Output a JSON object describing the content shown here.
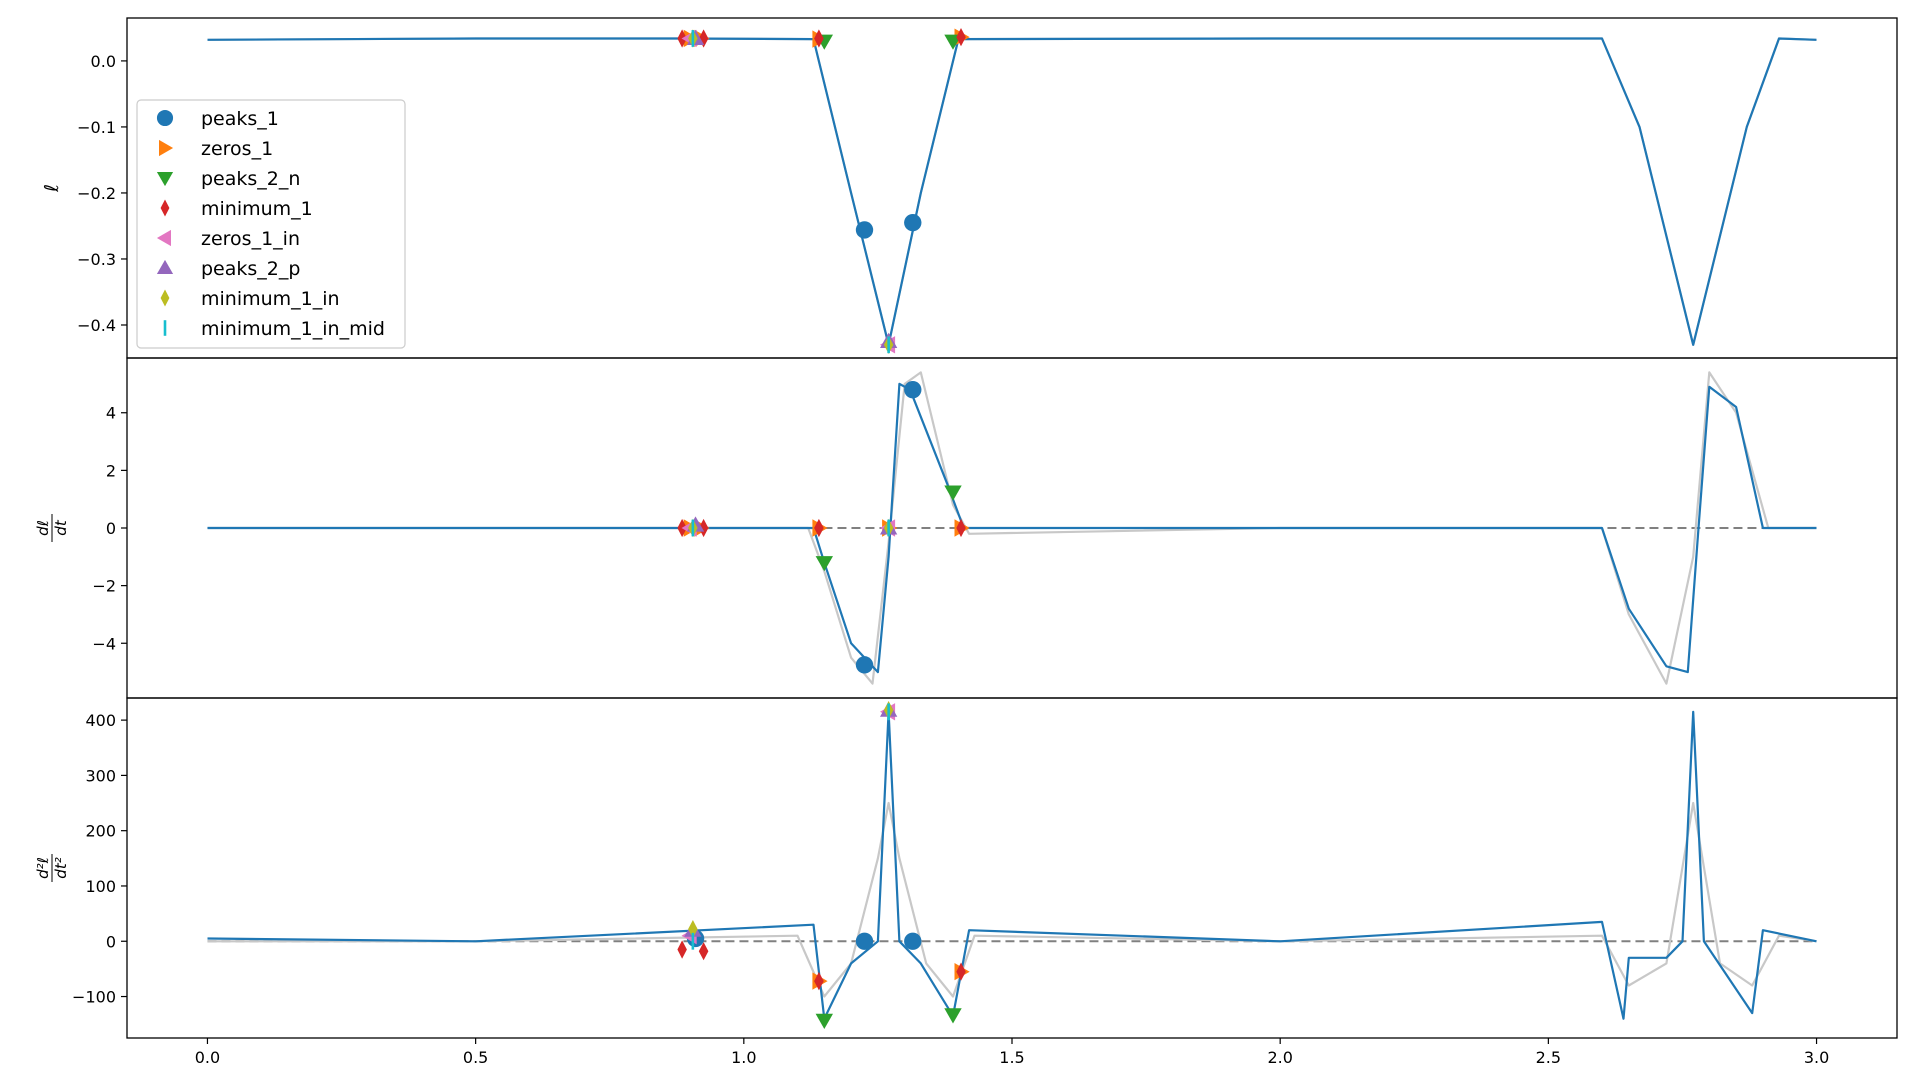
{
  "chart_data": {
    "type": "line",
    "panels": [
      {
        "ylabel": "ℓ",
        "ylim": [
          -0.45,
          0.065
        ],
        "yticks": [
          0.0,
          -0.1,
          -0.2,
          -0.3,
          -0.4
        ],
        "ytick_labels": [
          "0.0",
          "−0.1",
          "−0.2",
          "−0.3",
          "−0.4"
        ],
        "zero_line": false,
        "legend": {
          "placement": "center-left",
          "entries": [
            "peaks_1",
            "zeros_1",
            "peaks_2_n",
            "minimum_1",
            "zeros_1_in",
            "peaks_2_p",
            "minimum_1_in",
            "minimum_1_in_mid"
          ]
        },
        "series": [
          {
            "role": "reference",
            "color": "#c8c8c8",
            "x": [
              0,
              0.5,
              0.88,
              1.13,
              1.2,
              1.27,
              1.33,
              1.4,
              2.0,
              2.6,
              2.67,
              2.77,
              2.87,
              2.93,
              3.0
            ],
            "y": [
              0.032,
              0.034,
              0.034,
              0.033,
              -0.2,
              -0.43,
              -0.2,
              0.033,
              0.034,
              0.034,
              -0.1,
              -0.43,
              -0.1,
              0.034,
              0.032
            ]
          },
          {
            "role": "main",
            "color": "#1f77b4",
            "x": [
              0,
              0.5,
              0.88,
              1.13,
              1.2,
              1.27,
              1.33,
              1.4,
              2.0,
              2.6,
              2.67,
              2.77,
              2.87,
              2.93,
              3.0
            ],
            "y": [
              0.032,
              0.034,
              0.034,
              0.033,
              -0.2,
              -0.43,
              -0.2,
              0.033,
              0.034,
              0.034,
              -0.1,
              -0.43,
              -0.1,
              0.034,
              0.032
            ]
          }
        ],
        "markers": [
          {
            "name": "peaks_1",
            "x": [
              1.225,
              1.315
            ],
            "y": [
              -0.256,
              -0.245
            ]
          },
          {
            "name": "zeros_1",
            "x": [
              0.9,
              0.92,
              1.14,
              1.405
            ],
            "y": [
              0.034,
              0.034,
              0.033,
              0.036
            ]
          },
          {
            "name": "peaks_2_n",
            "x": [
              1.15,
              1.39
            ],
            "y": [
              0.03,
              0.03
            ]
          },
          {
            "name": "minimum_1",
            "x": [
              0.885,
              0.925,
              1.14,
              1.405
            ],
            "y": [
              0.034,
              0.034,
              0.034,
              0.036
            ]
          },
          {
            "name": "zeros_1_in",
            "x": [
              0.9,
              1.27
            ],
            "y": [
              0.034,
              -0.43
            ]
          },
          {
            "name": "peaks_2_p",
            "x": [
              0.91,
              1.27
            ],
            "y": [
              0.034,
              -0.425
            ]
          },
          {
            "name": "minimum_1_in",
            "x": [
              0.905,
              1.27
            ],
            "y": [
              0.034,
              -0.43
            ]
          },
          {
            "name": "minimum_1_in_mid",
            "x": [
              0.905,
              1.27
            ],
            "y": [
              0.034,
              -0.43
            ]
          }
        ]
      },
      {
        "ylabel": "dℓ/dt",
        "ylabel_num": "dℓ",
        "ylabel_den": "dt",
        "ylim": [
          -5.9,
          5.9
        ],
        "yticks": [
          4,
          2,
          0,
          -2,
          -4
        ],
        "ytick_labels": [
          "4",
          "2",
          "0",
          "−2",
          "−4"
        ],
        "zero_line": true,
        "series": [
          {
            "role": "reference",
            "color": "#c8c8c8",
            "x": [
              0,
              0.5,
              1.12,
              1.15,
              1.2,
              1.24,
              1.27,
              1.3,
              1.33,
              1.39,
              1.42,
              2.0,
              2.6,
              2.65,
              2.72,
              2.77,
              2.8,
              2.85,
              2.91,
              3.0
            ],
            "y": [
              0.0,
              0.0,
              0.0,
              -1.5,
              -4.5,
              -5.4,
              -0.5,
              5.0,
              5.4,
              0.8,
              -0.2,
              0.0,
              0.0,
              -3.0,
              -5.4,
              -1.0,
              5.4,
              4.0,
              0.0,
              0.0
            ]
          },
          {
            "role": "main",
            "color": "#1f77b4",
            "x": [
              0,
              0.5,
              1.13,
              1.15,
              1.2,
              1.25,
              1.27,
              1.29,
              1.31,
              1.38,
              1.41,
              2.0,
              2.6,
              2.65,
              2.72,
              2.76,
              2.78,
              2.8,
              2.85,
              2.9,
              3.0
            ],
            "y": [
              0.0,
              0.0,
              0.0,
              -1.2,
              -4.0,
              -5.0,
              -1.0,
              5.0,
              4.8,
              1.5,
              0.0,
              0.0,
              0.0,
              -2.8,
              -4.8,
              -5.0,
              0.0,
              4.9,
              4.2,
              0.0,
              0.0
            ]
          }
        ],
        "markers": [
          {
            "name": "peaks_1",
            "x": [
              1.225,
              1.315
            ],
            "y": [
              -4.75,
              4.8
            ]
          },
          {
            "name": "zeros_1",
            "x": [
              0.9,
              0.92,
              1.14,
              1.27,
              1.405
            ],
            "y": [
              0.0,
              0.0,
              0.0,
              0.0,
              0.0
            ]
          },
          {
            "name": "peaks_2_n",
            "x": [
              1.15,
              1.39
            ],
            "y": [
              -1.2,
              1.25
            ]
          },
          {
            "name": "minimum_1",
            "x": [
              0.885,
              0.925,
              1.14,
              1.405
            ],
            "y": [
              0.0,
              0.0,
              0.0,
              0.0
            ]
          },
          {
            "name": "zeros_1_in",
            "x": [
              0.9,
              1.27
            ],
            "y": [
              0.0,
              0.0
            ]
          },
          {
            "name": "peaks_2_p",
            "x": [
              0.91,
              1.27
            ],
            "y": [
              0.1,
              0.0
            ]
          },
          {
            "name": "minimum_1_in",
            "x": [
              0.905,
              1.27
            ],
            "y": [
              0.0,
              0.0
            ]
          },
          {
            "name": "minimum_1_in_mid",
            "x": [
              0.905,
              1.27
            ],
            "y": [
              0.0,
              0.0
            ]
          }
        ]
      },
      {
        "ylabel": "d²ℓ/dt²",
        "ylabel_num": "d²ℓ",
        "ylabel_den": "dt²",
        "ylim": [
          -175,
          440
        ],
        "yticks": [
          400,
          300,
          200,
          100,
          0,
          -100
        ],
        "ytick_labels": [
          "400",
          "300",
          "200",
          "100",
          "0",
          "−100"
        ],
        "zero_line": true,
        "series": [
          {
            "role": "reference",
            "color": "#c8c8c8",
            "x": [
              0,
              0.5,
              1.1,
              1.15,
              1.2,
              1.25,
              1.27,
              1.29,
              1.34,
              1.39,
              1.43,
              2.0,
              2.6,
              2.65,
              2.72,
              2.77,
              2.82,
              2.88,
              2.93,
              3.0
            ],
            "y": [
              0,
              0,
              10,
              -100,
              -40,
              150,
              250,
              150,
              -40,
              -100,
              10,
              0,
              10,
              -80,
              -40,
              250,
              -40,
              -80,
              10,
              0
            ]
          },
          {
            "role": "main",
            "color": "#1f77b4",
            "x": [
              0,
              0.5,
              1.13,
              1.15,
              1.2,
              1.25,
              1.27,
              1.29,
              1.33,
              1.39,
              1.42,
              2.0,
              2.6,
              2.64,
              2.65,
              2.72,
              2.75,
              2.77,
              2.79,
              2.88,
              2.9,
              3.0
            ],
            "y": [
              5,
              0,
              30,
              -140,
              -40,
              0,
              415,
              0,
              -40,
              -135,
              20,
              0,
              35,
              -140,
              -30,
              -30,
              0,
              415,
              0,
              -130,
              20,
              0
            ]
          }
        ],
        "markers": [
          {
            "name": "peaks_1",
            "x": [
              0.91,
              1.225,
              1.315
            ],
            "y": [
              5,
              0,
              0
            ]
          },
          {
            "name": "zeros_1",
            "x": [
              1.14,
              1.405
            ],
            "y": [
              -72,
              -55
            ]
          },
          {
            "name": "peaks_2_n",
            "x": [
              1.15,
              1.39
            ],
            "y": [
              -143,
              -133
            ]
          },
          {
            "name": "minimum_1",
            "x": [
              0.885,
              0.925,
              1.14,
              1.405
            ],
            "y": [
              -15,
              -18,
              -72,
              -55
            ]
          },
          {
            "name": "zeros_1_in",
            "x": [
              0.9,
              1.27
            ],
            "y": [
              10,
              415
            ]
          },
          {
            "name": "peaks_2_p",
            "x": [
              0.905,
              1.27
            ],
            "y": [
              20,
              418
            ]
          },
          {
            "name": "minimum_1_in",
            "x": [
              0.905,
              1.27
            ],
            "y": [
              22,
              418
            ]
          },
          {
            "name": "minimum_1_in_mid",
            "x": [
              0.905,
              1.27
            ],
            "y": [
              0,
              415
            ]
          }
        ]
      }
    ],
    "xlim": [
      -0.15,
      3.15
    ],
    "xticks": [
      0.0,
      0.5,
      1.0,
      1.5,
      2.0,
      2.5,
      3.0
    ],
    "xtick_labels": [
      "0.0",
      "0.5",
      "1.0",
      "1.5",
      "2.0",
      "2.5",
      "3.0"
    ],
    "marker_styles": [
      {
        "name": "peaks_1",
        "color": "#1f77b4",
        "shape": "circle"
      },
      {
        "name": "zeros_1",
        "color": "#ff7f0e",
        "shape": "triangle-right"
      },
      {
        "name": "peaks_2_n",
        "color": "#2ca02c",
        "shape": "triangle-down"
      },
      {
        "name": "minimum_1",
        "color": "#d62728",
        "shape": "thin-diamond"
      },
      {
        "name": "zeros_1_in",
        "color": "#e377c2",
        "shape": "triangle-left"
      },
      {
        "name": "peaks_2_p",
        "color": "#9467bd",
        "shape": "triangle-up"
      },
      {
        "name": "minimum_1_in",
        "color": "#bcbd22",
        "shape": "thin-diamond"
      },
      {
        "name": "minimum_1_in_mid",
        "color": "#17becf",
        "shape": "vline"
      }
    ],
    "grid": false
  }
}
